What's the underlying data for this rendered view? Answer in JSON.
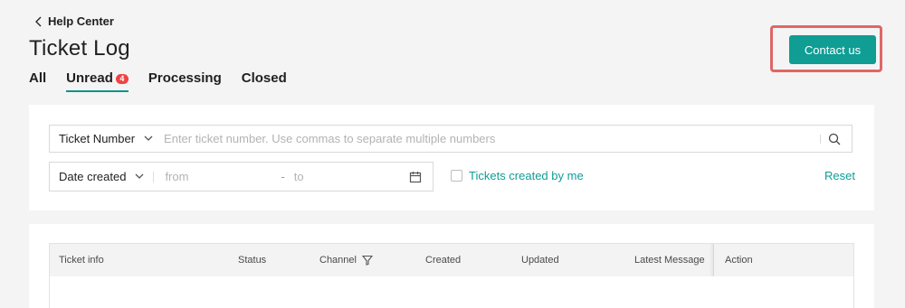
{
  "breadcrumb": {
    "label": "Help Center"
  },
  "page": {
    "title": "Ticket Log"
  },
  "tabs": [
    {
      "label": "All"
    },
    {
      "label": "Unread",
      "badge": "4",
      "active": true
    },
    {
      "label": "Processing"
    },
    {
      "label": "Closed"
    }
  ],
  "contact": {
    "label": "Contact us"
  },
  "filters": {
    "search_field": "Ticket Number",
    "search_placeholder": "Enter ticket number. Use commas to separate multiple numbers",
    "date_field": "Date created",
    "from_placeholder": "from",
    "range_dash": "-",
    "to_placeholder": "to",
    "mine_label": "Tickets created by me",
    "reset_label": "Reset"
  },
  "table": {
    "columns": [
      "Ticket info",
      "Status",
      "Channel",
      "Created",
      "Updated",
      "Latest Message",
      "Action"
    ]
  },
  "colors": {
    "accent": "#0f9d94",
    "badge": "#ef4444",
    "highlight": "#e06666"
  }
}
